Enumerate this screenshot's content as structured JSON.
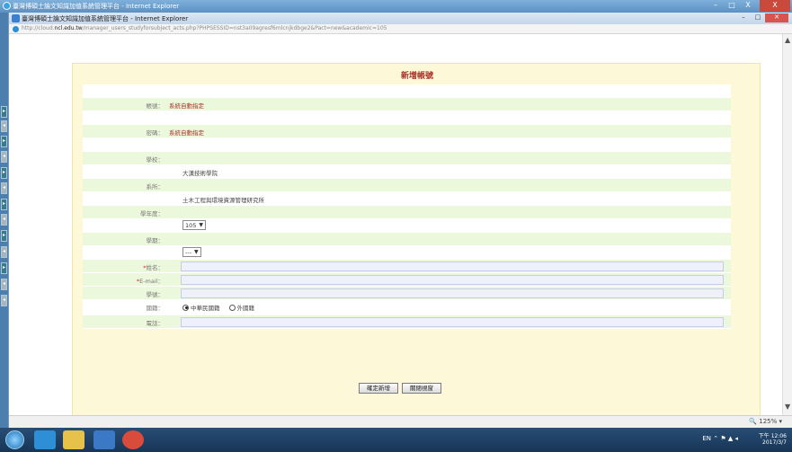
{
  "outer_window": {
    "title": "臺灣博碩士論文知識加值系統管理平台 - Internet Explorer",
    "controls": [
      "–",
      "□",
      "X"
    ],
    "close_far": "X"
  },
  "inner_window": {
    "title": "臺灣博碩士論文知識加值系統管理平台 - Internet Explorer",
    "controls": [
      "–",
      "□",
      "✕"
    ],
    "url_prefix": "http://cloud.",
    "url_domain": "ncl.edu.tw",
    "url_rest": "/manager_users_studyforsubject_acts.php?PHPSESSID=nst3a09agresf6mlcnjkdbge2&Pact=new&academic=105"
  },
  "form": {
    "title": "新增帳號",
    "rows": {
      "account_label": "帳號：",
      "account_value": "系統自動指定",
      "password_label": "密碼：",
      "password_value": "系統自動指定",
      "school_label": "學校：",
      "school_value": "大漢技術學院",
      "dept_label": "系所：",
      "dept_value": "土木工程與環境資源管理研究所",
      "year_label": "學年度：",
      "year_value": "105",
      "term_label": "學期：",
      "term_value": "---",
      "name_label": "姓名：",
      "email_label": "E-mail：",
      "studentid_label": "學號：",
      "nationality_label": "國籍：",
      "nationality_options": [
        "中華民國籍",
        "外國籍"
      ],
      "nationality_selected": 0,
      "phone_label": "電話：",
      "required_mark": "*"
    },
    "buttons": {
      "confirm": "確定新增",
      "close": "關閉視窗"
    }
  },
  "statusbar": {
    "zoom": "125%"
  },
  "taskbar": {
    "time": "下午 12:06",
    "date": "2017/3/7",
    "lang": "EN"
  },
  "colors": {
    "panel_bg": "#fdf9d8",
    "row_green": "#ecf8dc",
    "title_red": "#a6322a",
    "input_bg": "#eef0fb"
  }
}
